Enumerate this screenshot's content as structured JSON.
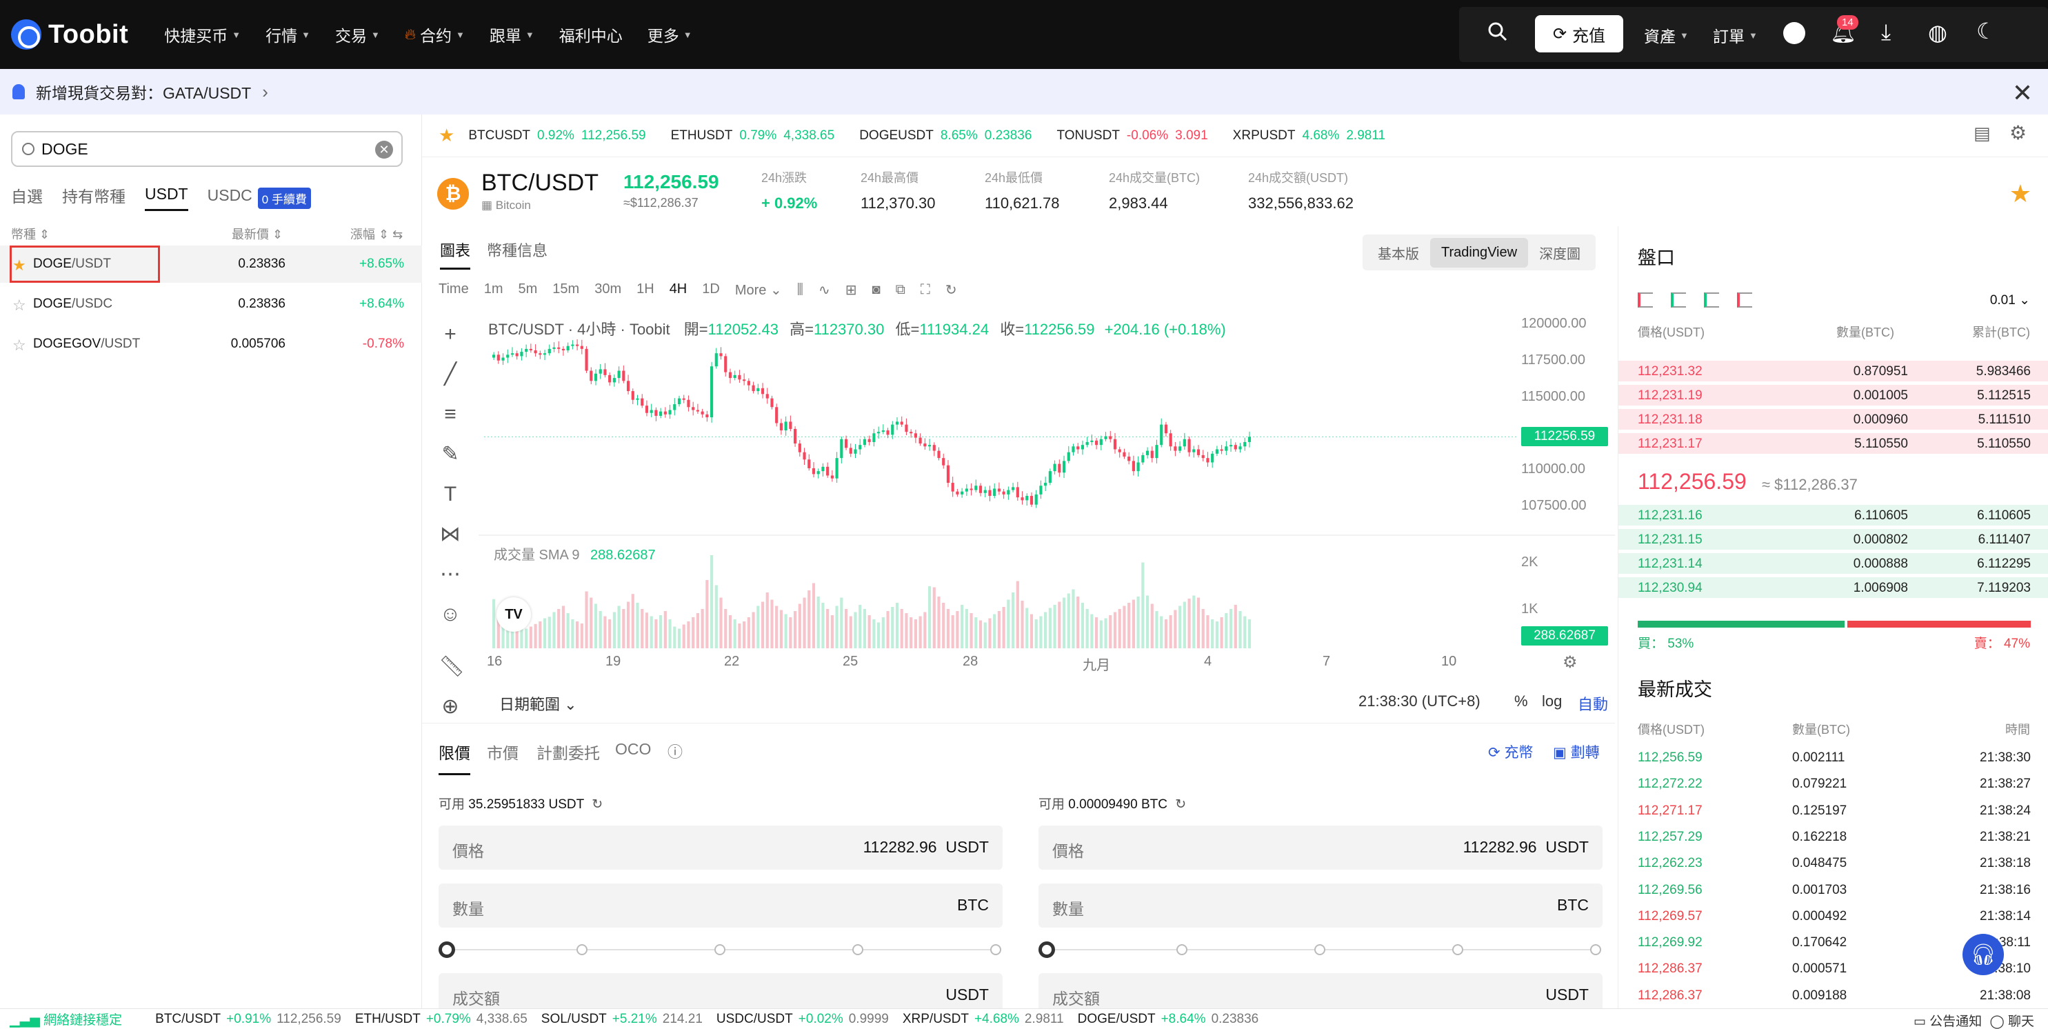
{
  "nav": {
    "logo": "Toobit",
    "items": [
      {
        "label": "快捷买币",
        "caret": true
      },
      {
        "label": "行情",
        "caret": true
      },
      {
        "label": "交易",
        "caret": true
      },
      {
        "label": "合约",
        "caret": true,
        "fire": true
      },
      {
        "label": "跟單",
        "caret": true
      },
      {
        "label": "福利中心",
        "caret": false
      },
      {
        "label": "更多",
        "caret": true
      }
    ],
    "deposit": "充值",
    "assets": "資產",
    "orders": "訂單",
    "notif_count": "14"
  },
  "announcement": {
    "text": "新增現貨交易對：GATA/USDT"
  },
  "search": {
    "value": "DOGE"
  },
  "left_tabs": [
    "自選",
    "持有幣種",
    "USDT",
    "USDC"
  ],
  "active_left_tab": "USDT",
  "fee_badge": "0 手續費",
  "list_header": {
    "col1": "幣種 ⇕",
    "col2": "最新價 ⇕",
    "col3": "漲幅 ⇕ ⇆"
  },
  "pairs": [
    {
      "base": "DOGE",
      "quote": "/USDT",
      "price": "0.23836",
      "change": "+8.65%",
      "fav": true,
      "dir": "up"
    },
    {
      "base": "DOGE",
      "quote": "/USDC",
      "price": "0.23836",
      "change": "+8.64%",
      "fav": false,
      "dir": "up"
    },
    {
      "base": "DOGEGOV",
      "quote": "/USDT",
      "price": "0.005706",
      "change": "-0.78%",
      "fav": false,
      "dir": "down"
    }
  ],
  "ticker": [
    {
      "sym": "BTCUSDT",
      "pct": "0.92%",
      "price": "112,256.59",
      "dir": "up"
    },
    {
      "sym": "ETHUSDT",
      "pct": "0.79%",
      "price": "4,338.65",
      "dir": "up"
    },
    {
      "sym": "DOGEUSDT",
      "pct": "8.65%",
      "price": "0.23836",
      "dir": "up"
    },
    {
      "sym": "TONUSDT",
      "pct": "-0.06%",
      "price": "3.091",
      "dir": "down"
    },
    {
      "sym": "XRPUSDT",
      "pct": "4.68%",
      "price": "2.9811",
      "dir": "up"
    }
  ],
  "pair": {
    "name": "BTC/USDT",
    "sub": "Bitcoin",
    "last": "112,256.59",
    "last_usd": "≈$112,286.37",
    "stats": [
      {
        "label": "24h漲跌",
        "value": "+ 0.92%",
        "green": true
      },
      {
        "label": "24h最高價",
        "value": "112,370.30"
      },
      {
        "label": "24h最低價",
        "value": "110,621.78"
      },
      {
        "label": "24h成交量(BTC)",
        "value": "2,983.44"
      },
      {
        "label": "24h成交額(USDT)",
        "value": "332,556,833.62"
      }
    ]
  },
  "chart_tabs": [
    "圖表",
    "幣種信息"
  ],
  "view_switch": [
    "基本版",
    "TradingView",
    "深度圖"
  ],
  "intervals": [
    "Time",
    "1m",
    "5m",
    "15m",
    "30m",
    "1H",
    "4H",
    "1D",
    "More ⌄"
  ],
  "active_interval": "4H",
  "chart_data": {
    "type": "candlestick",
    "title": "BTC/USDT · 4小時 · Toobit",
    "ohlc": {
      "open": "112052.43",
      "high": "112370.30",
      "low": "111934.24",
      "close": "112256.59",
      "change": "+204.16 (+0.18%)"
    },
    "ohlc_labels": {
      "o": "開=",
      "h": "高=",
      "l": "低=",
      "c": "收="
    },
    "y_ticks": [
      "120000.00",
      "117500.00",
      "115000.00",
      "110000.00",
      "107500.00"
    ],
    "ylim": [
      105500,
      120000
    ],
    "last_price_tag": "112256.59",
    "x_ticks": [
      "16",
      "19",
      "22",
      "25",
      "28",
      "九月",
      "4",
      "7",
      "10"
    ],
    "volume_label": "成交量 SMA 9",
    "volume_sma": "288.62687",
    "volume_ticks": [
      "2K",
      "1K"
    ],
    "ylim_volume": [
      0,
      2400
    ],
    "closes": [
      117900,
      117500,
      117700,
      117900,
      118000,
      117800,
      118100,
      118300,
      118200,
      118000,
      117900,
      118000,
      118300,
      118400,
      118300,
      118200,
      118500,
      118600,
      118500,
      118300,
      116800,
      116100,
      116600,
      116900,
      116500,
      116000,
      116300,
      116800,
      116100,
      115400,
      114800,
      114900,
      114400,
      113900,
      114100,
      113700,
      114000,
      113800,
      114100,
      114500,
      114900,
      114800,
      114300,
      114100,
      114000,
      113800,
      113600,
      117100,
      118000,
      117800,
      116700,
      116300,
      116500,
      116200,
      116100,
      115800,
      115400,
      115600,
      115200,
      114900,
      114300,
      113200,
      112700,
      113300,
      112800,
      111800,
      111200,
      110700,
      110100,
      109700,
      109900,
      110200,
      109600,
      109400,
      110800,
      112100,
      111500,
      111100,
      111400,
      111700,
      112100,
      111900,
      112500,
      112600,
      112700,
      112400,
      113100,
      113300,
      113100,
      112600,
      112500,
      112200,
      111800,
      111600,
      111700,
      111300,
      110800,
      110300,
      109100,
      108500,
      108300,
      108500,
      108700,
      108600,
      108900,
      108400,
      108600,
      108200,
      108700,
      108500,
      108300,
      108600,
      108800,
      108100,
      107900,
      108200,
      107600,
      108300,
      108900,
      109100,
      109900,
      110400,
      109800,
      110600,
      111200,
      111600,
      111400,
      111700,
      111900,
      112000,
      111700,
      112100,
      112300,
      112100,
      111400,
      111200,
      110900,
      110600,
      109900,
      110500,
      111000,
      111300,
      110800,
      111700,
      113100,
      112500,
      111600,
      111300,
      111600,
      112100,
      111200,
      111400,
      111000,
      110800,
      110500,
      111100,
      111400,
      111300,
      111600,
      111700,
      111400,
      111600,
      111900,
      112256
    ],
    "volumes": [
      950,
      700,
      620,
      540,
      460,
      500,
      430,
      380,
      420,
      470,
      520,
      580,
      610,
      700,
      760,
      820,
      680,
      560,
      520,
      480,
      1100,
      980,
      860,
      720,
      620,
      560,
      700,
      820,
      760,
      900,
      1050,
      880,
      760,
      690,
      620,
      560,
      640,
      720,
      560,
      420,
      380,
      460,
      520,
      600,
      680,
      760,
      1320,
      1800,
      1220,
      980,
      760,
      640,
      560,
      480,
      520,
      600,
      700,
      820,
      900,
      1080,
      940,
      820,
      740,
      660,
      600,
      720,
      860,
      980,
      1120,
      1260,
      1000,
      880,
      760,
      640,
      820,
      980,
      760,
      620,
      700,
      840,
      760,
      640,
      560,
      500,
      600,
      720,
      800,
      880,
      760,
      680,
      600,
      560,
      620,
      700,
      1200,
      1180,
      1000,
      880,
      760,
      640,
      720,
      840,
      760,
      680,
      600,
      540,
      500,
      580,
      660,
      720,
      800,
      940,
      1080,
      1300,
      920,
      780,
      660,
      560,
      620,
      700,
      780,
      840,
      900,
      980,
      1060,
      1140,
      1000,
      880,
      760,
      660,
      600,
      540,
      580,
      640,
      700,
      760,
      820,
      880,
      940,
      1000,
      1660,
      1020,
      860,
      720,
      620,
      560,
      640,
      740,
      820,
      900,
      960,
      1020,
      980,
      760,
      640,
      560,
      520,
      600,
      680,
      760,
      840,
      720,
      620,
      560,
      500,
      460,
      520,
      600,
      700,
      780,
      420
    ]
  },
  "date_range": "日期範圍 ⌄",
  "clock": "21:38:30 (UTC+8)",
  "chart_opts": [
    "%",
    "log",
    "自動"
  ],
  "order_tabs": [
    "限價",
    "市價",
    "計劃委托",
    "OCO"
  ],
  "order_links": {
    "deposit": "充幣",
    "transfer": "劃轉"
  },
  "buy": {
    "avail_label": "可用",
    "avail": "35.25951833 USDT",
    "price_label": "價格",
    "price": "112282.96",
    "price_unit": "USDT",
    "qty_label": "數量",
    "qty_unit": "BTC",
    "total_label": "成交額",
    "total_unit": "USDT"
  },
  "sell": {
    "avail_label": "可用",
    "avail": "0.00009490 BTC",
    "price_label": "價格",
    "price": "112282.96",
    "price_unit": "USDT",
    "qty_label": "數量",
    "qty_unit": "BTC",
    "total_label": "成交額",
    "total_unit": "USDT"
  },
  "orderbook": {
    "title": "盤口",
    "precision": "0.01 ⌄",
    "headers": [
      "價格(USDT)",
      "數量(BTC)",
      "累計(BTC)"
    ],
    "asks": [
      {
        "p": "112,231.32",
        "q": "0.870951",
        "t": "5.983466",
        "depth": 1.0
      },
      {
        "p": "112,231.19",
        "q": "0.001005",
        "t": "5.112515",
        "depth": 1.0
      },
      {
        "p": "112,231.18",
        "q": "0.000960",
        "t": "5.111510",
        "depth": 1.0
      },
      {
        "p": "112,231.17",
        "q": "5.110550",
        "t": "5.110550",
        "depth": 1.0
      }
    ],
    "mid": "112,256.59",
    "mid_usd": "≈ $112,286.37",
    "bids": [
      {
        "p": "112,231.16",
        "q": "6.110605",
        "t": "6.110605",
        "depth": 1.0
      },
      {
        "p": "112,231.15",
        "q": "0.000802",
        "t": "6.111407",
        "depth": 1.0
      },
      {
        "p": "112,231.14",
        "q": "0.000888",
        "t": "6.112295",
        "depth": 1.0
      },
      {
        "p": "112,230.94",
        "q": "1.006908",
        "t": "7.119203",
        "depth": 1.0
      }
    ],
    "buy_ratio": "買： 53%",
    "sell_ratio": "賣： 47%",
    "buy_pct": 53
  },
  "trades": {
    "title": "最新成交",
    "headers": [
      "價格(USDT)",
      "數量(BTC)",
      "時間"
    ],
    "rows": [
      {
        "p": "112,256.59",
        "q": "0.002111",
        "t": "21:38:30",
        "dir": "up"
      },
      {
        "p": "112,272.22",
        "q": "0.079221",
        "t": "21:38:27",
        "dir": "up"
      },
      {
        "p": "112,271.17",
        "q": "0.125197",
        "t": "21:38:24",
        "dir": "down"
      },
      {
        "p": "112,257.29",
        "q": "0.162218",
        "t": "21:38:21",
        "dir": "up"
      },
      {
        "p": "112,262.23",
        "q": "0.048475",
        "t": "21:38:18",
        "dir": "up"
      },
      {
        "p": "112,269.56",
        "q": "0.001703",
        "t": "21:38:16",
        "dir": "up"
      },
      {
        "p": "112,269.57",
        "q": "0.000492",
        "t": "21:38:14",
        "dir": "down"
      },
      {
        "p": "112,269.92",
        "q": "0.170642",
        "t": "21:38:11",
        "dir": "up"
      },
      {
        "p": "112,286.37",
        "q": "0.000571",
        "t": "21:38:10",
        "dir": "down"
      },
      {
        "p": "112,286.37",
        "q": "0.009188",
        "t": "21:38:08",
        "dir": "down"
      }
    ]
  },
  "statusbar": {
    "net": "網絡鏈接穩定",
    "items": [
      {
        "sym": "BTC/USDT",
        "chg": "+0.91%",
        "price": "112,256.59"
      },
      {
        "sym": "ETH/USDT",
        "chg": "+0.79%",
        "price": "4,338.65"
      },
      {
        "sym": "SOL/USDT",
        "chg": "+5.21%",
        "price": "214.21"
      },
      {
        "sym": "USDC/USDT",
        "chg": "+0.02%",
        "price": "0.9999"
      },
      {
        "sym": "XRP/USDT",
        "chg": "+4.68%",
        "price": "2.9811"
      },
      {
        "sym": "DOGE/USDT",
        "chg": "+8.64%",
        "price": "0.23836"
      }
    ],
    "announce": "公告通知",
    "chat": "聊天"
  },
  "colors": {
    "up": "#0ecb81",
    "down": "#f6465d",
    "brand": "#2b57d8"
  }
}
